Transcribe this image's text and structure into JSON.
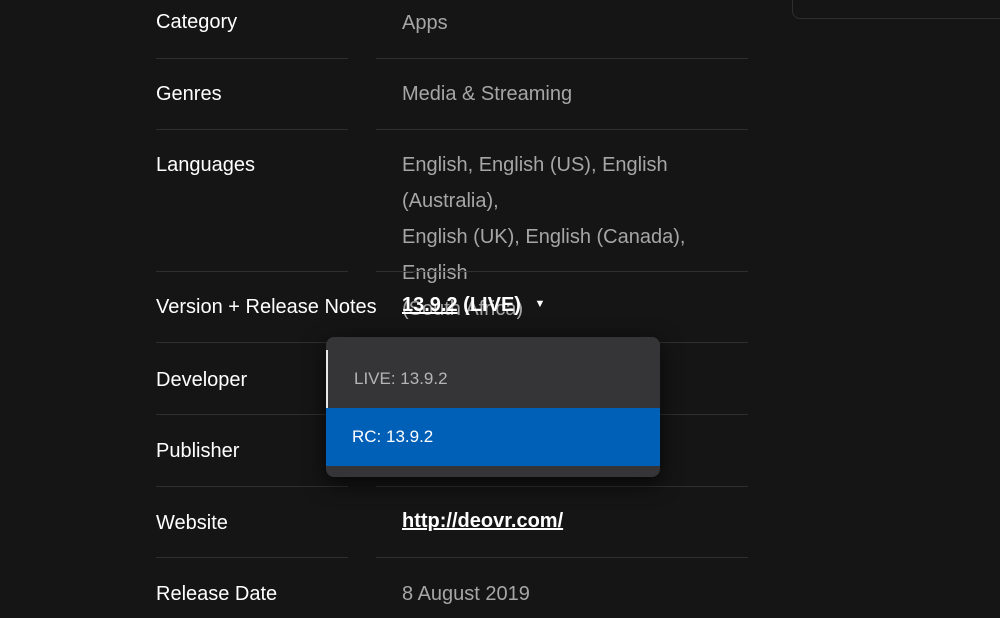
{
  "details": {
    "category": {
      "label": "Category",
      "value": "Apps"
    },
    "genres": {
      "label": "Genres",
      "value": "Media & Streaming"
    },
    "languages": {
      "label": "Languages",
      "lines": [
        "English, English (US), English (Australia),",
        "English (UK), English (Canada), English",
        "(South Africa)"
      ]
    },
    "version": {
      "label": "Version + Release Notes",
      "number": "13.9.2",
      "channel": "(LIVE)",
      "caret_icon": "chevron-down-icon"
    },
    "developer": {
      "label": "Developer"
    },
    "publisher": {
      "label": "Publisher"
    },
    "website": {
      "label": "Website",
      "url": "http://deovr.com/"
    },
    "release_date": {
      "label": "Release Date",
      "value": "8 August 2019"
    }
  },
  "version_dropdown": {
    "options": [
      {
        "label": "LIVE: 13.9.2",
        "selected": false
      },
      {
        "label": "RC: 13.9.2",
        "selected": true
      }
    ],
    "highlight_color": "#005fb7"
  },
  "colors": {
    "background": "#151515",
    "label_text": "#ffffff",
    "value_text": "#a6a6a6",
    "divider": "#2f2f2f",
    "dropdown_bg": "#353537"
  }
}
